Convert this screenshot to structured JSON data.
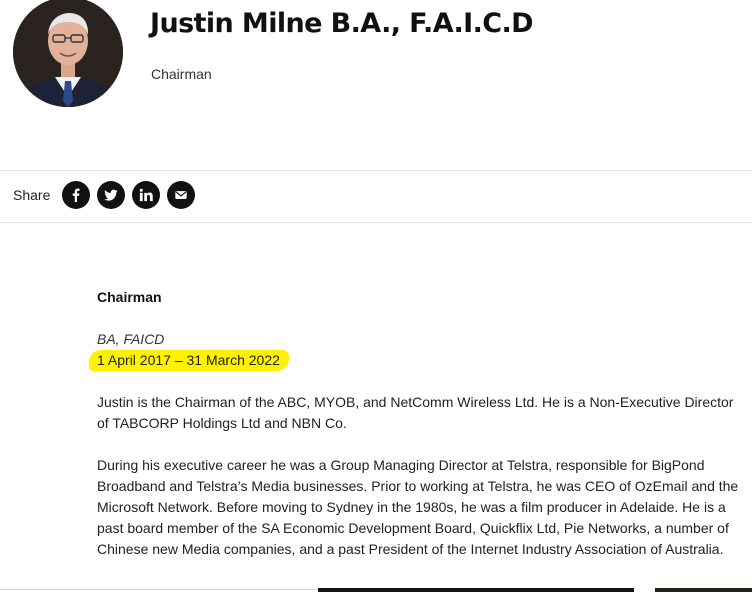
{
  "profile": {
    "name": "Justin Milne B.A., F.A.I.C.D",
    "role": "Chairman"
  },
  "share": {
    "label": "Share",
    "buttons": [
      {
        "icon": "facebook-icon"
      },
      {
        "icon": "twitter-icon"
      },
      {
        "icon": "linkedin-icon"
      },
      {
        "icon": "email-icon"
      }
    ]
  },
  "article": {
    "heading": "Chairman",
    "credentials": "BA, FAICD",
    "tenure": "1 April 2017 – 31 March 2022",
    "paragraphs": [
      "Justin is the Chairman of the ABC, MYOB, and NetComm Wireless Ltd.  He is a Non-Executive Director of TABCORP Holdings Ltd and NBN Co.",
      "During his executive career he was a Group Managing Director at Telstra, responsible for BigPond Broadband and Telstra’s Media businesses. Prior to working at Telstra, he was CEO of OzEmail and the Microsoft Network.  Before moving to Sydney in the 1980s, he was a film producer in Adelaide. He is a past board member of the SA Economic Development Board, Quickflix Ltd, Pie Networks, a number of Chinese new Media companies, and a past President of the Internet Industry Association of Australia."
    ]
  },
  "colors": {
    "highlight": "#fff200",
    "icon_bg": "#111111"
  }
}
